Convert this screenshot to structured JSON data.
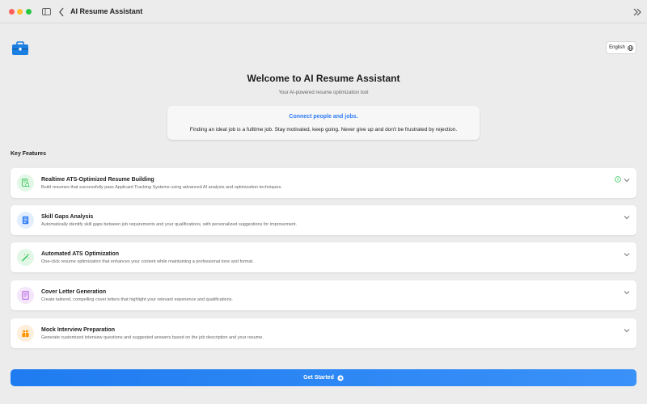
{
  "window": {
    "title": "AI Resume Assistant"
  },
  "language": {
    "label": "English"
  },
  "hero": {
    "title": "Welcome to AI Resume Assistant",
    "subtitle": "Your AI-powered resume optimization tool",
    "quote_heading": "Connect people and jobs.",
    "quote_text": "Finding an ideal job is a fulltime job. Stay motivated, keep going. Never give up and don't be frustrated by rejection."
  },
  "features_label": "Key Features",
  "features": [
    {
      "title": "Realtime ATS-Optimized Resume Building",
      "description": "Build resumes that successfully pass Applicant Tracking Systems using advanced AI analysis and optimization techniques.",
      "icon": "resume-search-icon",
      "color": "#34c759"
    },
    {
      "title": "Skill Gaps Analysis",
      "description": "Automatically identify skill gaps between job requirements and your qualifications, with personalized suggestions for improvement.",
      "icon": "document-icon",
      "color": "#2f7cf6"
    },
    {
      "title": "Automated ATS Optimization",
      "description": "One-click resume optimization that enhances your content while maintaining a professional tone and format.",
      "icon": "magic-wand-icon",
      "color": "#34c759"
    },
    {
      "title": "Cover Letter Generation",
      "description": "Create tailored, compelling cover letters that highlight your relevant experience and qualifications.",
      "icon": "letter-icon",
      "color": "#af52de"
    },
    {
      "title": "Mock Interview Preparation",
      "description": "Generate customized interview questions and suggested answers based on the job description and your resume.",
      "icon": "interview-icon",
      "color": "#ff9500"
    }
  ],
  "cta": {
    "label": "Get Started"
  },
  "colors": {
    "accent": "#2f7cf6",
    "background": "#ececec"
  }
}
